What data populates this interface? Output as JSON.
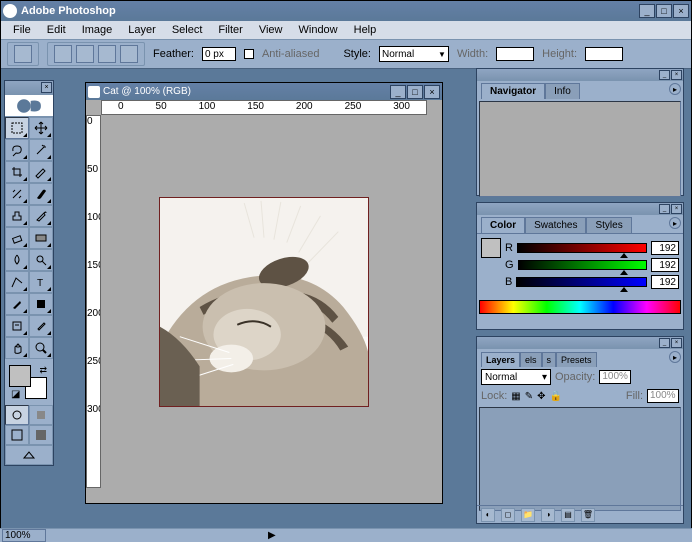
{
  "app_title": "Adobe Photoshop",
  "menu": [
    "File",
    "Edit",
    "Image",
    "Layer",
    "Select",
    "Filter",
    "View",
    "Window",
    "Help"
  ],
  "options": {
    "feather_label": "Feather:",
    "feather_value": "0 px",
    "antialias_label": "Anti-aliased",
    "style_label": "Style:",
    "style_value": "Normal",
    "width_label": "Width:",
    "height_label": "Height:"
  },
  "document": {
    "title": "Cat @ 100% (RGB)",
    "ruler_h": [
      "0",
      "50",
      "100",
      "150",
      "200",
      "250",
      "300"
    ],
    "ruler_v": [
      "0",
      "50",
      "100",
      "150",
      "200",
      "250",
      "300"
    ]
  },
  "navigator": {
    "tabs": [
      "Navigator",
      "Info"
    ]
  },
  "color": {
    "tabs": [
      "Color",
      "Swatches",
      "Styles"
    ],
    "channels": [
      {
        "label": "R",
        "value": "192",
        "c1": "#000",
        "c2": "#f00"
      },
      {
        "label": "G",
        "value": "192",
        "c1": "#000",
        "c2": "#0f0"
      },
      {
        "label": "B",
        "value": "192",
        "c1": "#000",
        "c2": "#00f"
      }
    ]
  },
  "layers": {
    "tabs": [
      "Layers",
      "els",
      "s",
      "Presets"
    ],
    "mode": "Normal",
    "opacity_label": "Opacity:",
    "opacity_value": "100%",
    "lock_label": "Lock:",
    "fill_label": "Fill:",
    "fill_value": "100%"
  },
  "tools": [
    "marquee",
    "move",
    "lasso",
    "wand",
    "crop",
    "slice",
    "heal",
    "brush",
    "stamp",
    "history",
    "eraser",
    "gradient",
    "blur",
    "dodge",
    "path",
    "type",
    "pen",
    "shape",
    "notes",
    "eyedrop",
    "hand",
    "zoom"
  ],
  "status": {
    "zoom": "100%"
  }
}
